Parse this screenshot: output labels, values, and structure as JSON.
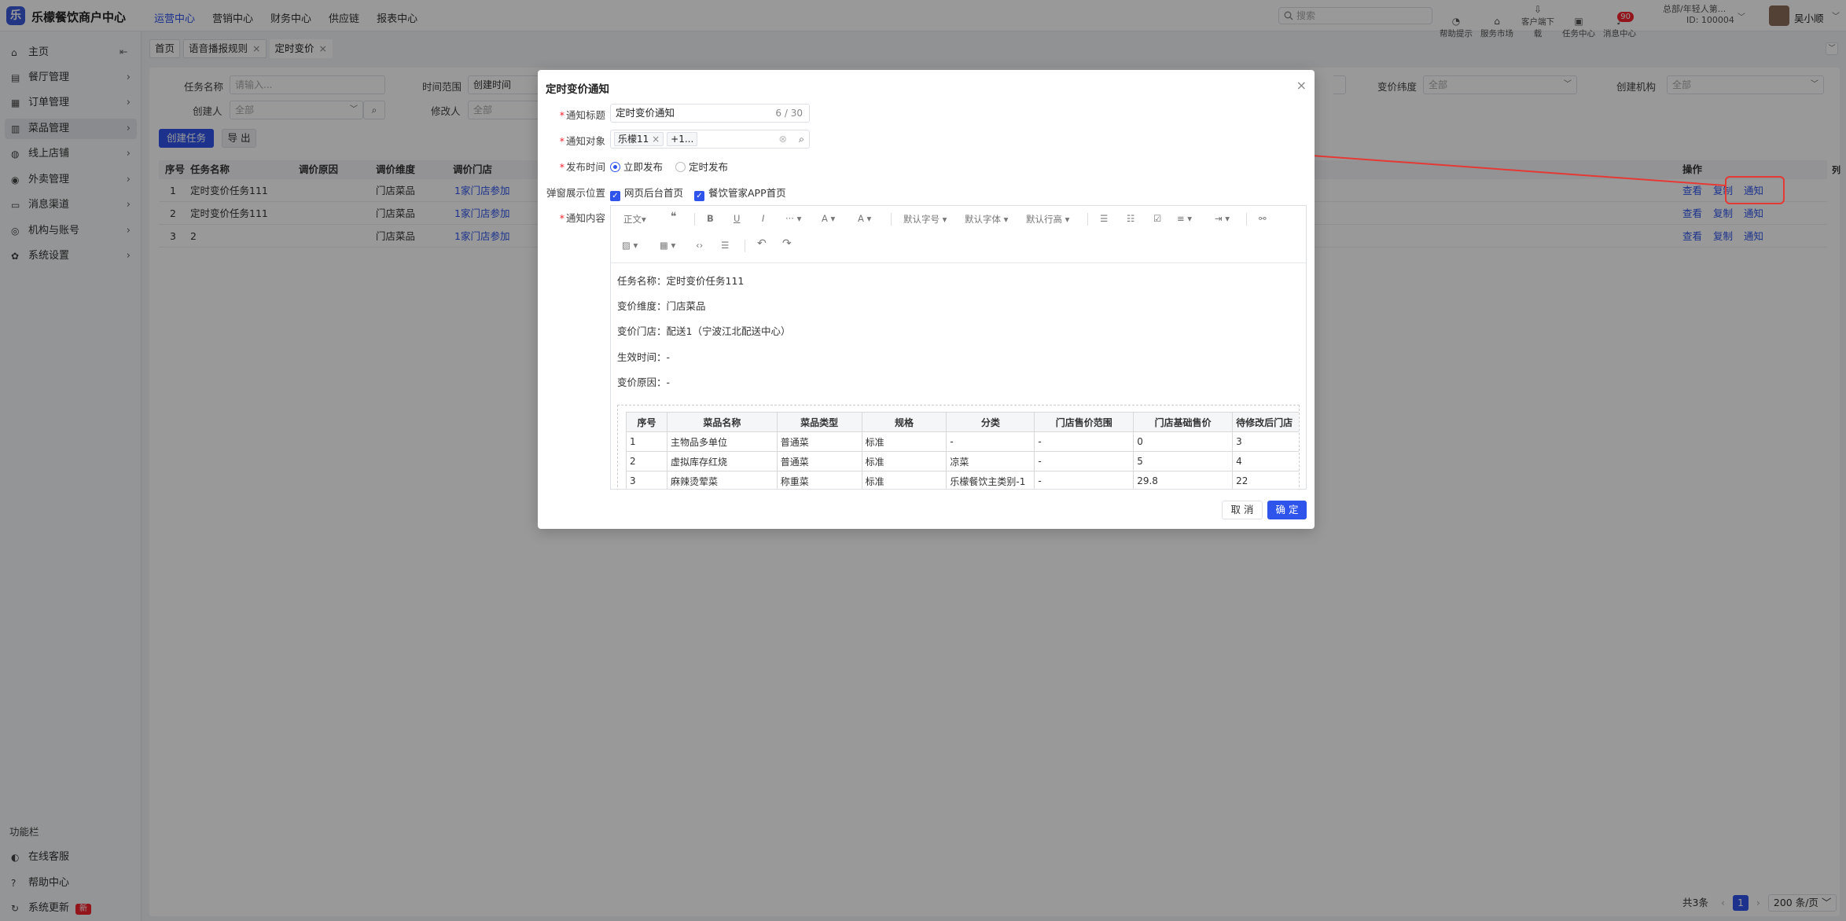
{
  "app": {
    "logo_glyph": "乐",
    "name": "乐檬餐饮商户中心"
  },
  "topnav": [
    "运营中心",
    "营销中心",
    "财务中心",
    "供应链",
    "报表中心"
  ],
  "search_placeholder": "搜索",
  "tools": [
    {
      "icon": "lightbulb-icon",
      "glyph": "◔",
      "label": "帮助提示"
    },
    {
      "icon": "shop-icon",
      "glyph": "⌂",
      "label": "服务市场"
    },
    {
      "icon": "download-icon",
      "glyph": "⇩",
      "label": "客户端下载"
    },
    {
      "icon": "task-icon",
      "glyph": "▣",
      "label": "任务中心"
    },
    {
      "icon": "bell-icon",
      "glyph": "♪",
      "label": "消息中心",
      "badge": "90"
    }
  ],
  "org": {
    "name": "总部/年轻人第...",
    "id": "ID: 100004"
  },
  "user": "吴小顺",
  "sidebar": {
    "items": [
      {
        "icon": "home-icon",
        "glyph": "⌂",
        "label": "主页"
      },
      {
        "icon": "restaurant-icon",
        "glyph": "▤",
        "label": "餐厅管理"
      },
      {
        "icon": "order-icon",
        "glyph": "▦",
        "label": "订单管理"
      },
      {
        "icon": "menu-icon",
        "glyph": "▥",
        "label": "菜品管理"
      },
      {
        "icon": "online-store-icon",
        "glyph": "◍",
        "label": "线上店铺"
      },
      {
        "icon": "delivery-icon",
        "glyph": "◉",
        "label": "外卖管理"
      },
      {
        "icon": "message-icon",
        "glyph": "▭",
        "label": "消息渠道"
      },
      {
        "icon": "org-icon",
        "glyph": "◎",
        "label": "机构与账号"
      },
      {
        "icon": "settings-icon",
        "glyph": "✿",
        "label": "系统设置"
      }
    ],
    "function_title": "功能栏",
    "footer": [
      {
        "icon": "service-icon",
        "glyph": "◐",
        "label": "在线客服"
      },
      {
        "icon": "help-icon",
        "glyph": "?",
        "label": "帮助中心"
      },
      {
        "icon": "update-icon",
        "glyph": "↻",
        "label": "系统更新",
        "badge": "新"
      }
    ],
    "collapse_glyph": "⇤"
  },
  "tabs": [
    {
      "label": "首页"
    },
    {
      "label": "语音播报规则",
      "close": "×"
    },
    {
      "label": "定时变价",
      "close": "×"
    }
  ],
  "filters": {
    "task_name_label": "任务名称",
    "task_name_placeholder": "请输入...",
    "time_label": "时间范围",
    "time_value": "创建时间",
    "creator_label": "创建人",
    "creator_value": "全部",
    "modifier_label": "修改人",
    "modifier_value": "全部",
    "dim_label": "变价纬度",
    "dim_value": "全部",
    "org_label": "创建机构",
    "org_value": "全部"
  },
  "buttons": {
    "create": "创建任务",
    "export": "导 出"
  },
  "table": {
    "headers": [
      "序号",
      "任务名称",
      "调价原因",
      "调价维度",
      "调价门店"
    ],
    "op_header": "操作",
    "col_glyph": "列",
    "rows": [
      {
        "no": "1",
        "name": "定时变价任务111",
        "reason": "",
        "dim": "门店菜品",
        "store": "1家门店参加"
      },
      {
        "no": "2",
        "name": "定时变价任务111",
        "reason": "",
        "dim": "门店菜品",
        "store": "1家门店参加"
      },
      {
        "no": "3",
        "name": "2",
        "reason": "",
        "dim": "门店菜品",
        "store": "1家门店参加"
      }
    ],
    "ops": [
      "查看",
      "复制",
      "通知"
    ]
  },
  "pager": {
    "total": "共3条",
    "prev": "‹",
    "page": "1",
    "next": "›",
    "size": "200 条/页"
  },
  "modal": {
    "title": "定时变价通知",
    "close": "×",
    "title_label": "通知标题",
    "title_value": "定时变价通知",
    "title_count": "6 / 30",
    "target_label": "通知对象",
    "target_tag": "乐檬11",
    "target_more": "+1...",
    "time_label": "发布时间",
    "time_now": "立即发布",
    "time_timed": "定时发布",
    "popup_label": "弹窗展示位置",
    "popup_web": "网页后台首页",
    "popup_app": "餐饮管家APP首页",
    "content_label": "通知内容",
    "toolbar1": [
      "正文▾",
      "❝",
      "B",
      "U",
      "I",
      "··· ▾",
      "A ▾",
      "A ▾",
      "默认字号 ▾",
      "默认字体 ▾",
      "默认行高 ▾",
      "☰",
      "☷",
      "☑",
      "≡ ▾",
      "⇥ ▾",
      "⚯"
    ],
    "toolbar2": [
      "▨ ▾",
      "▦ ▾",
      "‹›",
      "☰",
      "↶",
      "↷"
    ],
    "lines": [
      "任务名称：定时变价任务111",
      "变价维度：门店菜品",
      "变价门店：配送1（宁波江北配送中心）",
      "生效时间：-",
      "变价原因：-"
    ],
    "inner_headers": [
      "序号",
      "菜品名称",
      "菜品类型",
      "规格",
      "分类",
      "门店售价范围",
      "门店基础售价",
      "待修改后门店"
    ],
    "inner_rows": [
      [
        "1",
        "主物品多单位",
        "普通菜",
        "标准",
        "-",
        "-",
        "0",
        "3"
      ],
      [
        "2",
        "虚拟库存红烧",
        "普通菜",
        "标准",
        "凉菜",
        "-",
        "5",
        "4"
      ],
      [
        "3",
        "麻辣烫荤菜",
        "称重菜",
        "标准",
        "乐檬餐饮主类别-1",
        "-",
        "29.8",
        "22"
      ]
    ],
    "cancel": "取 消",
    "ok": "确 定"
  }
}
